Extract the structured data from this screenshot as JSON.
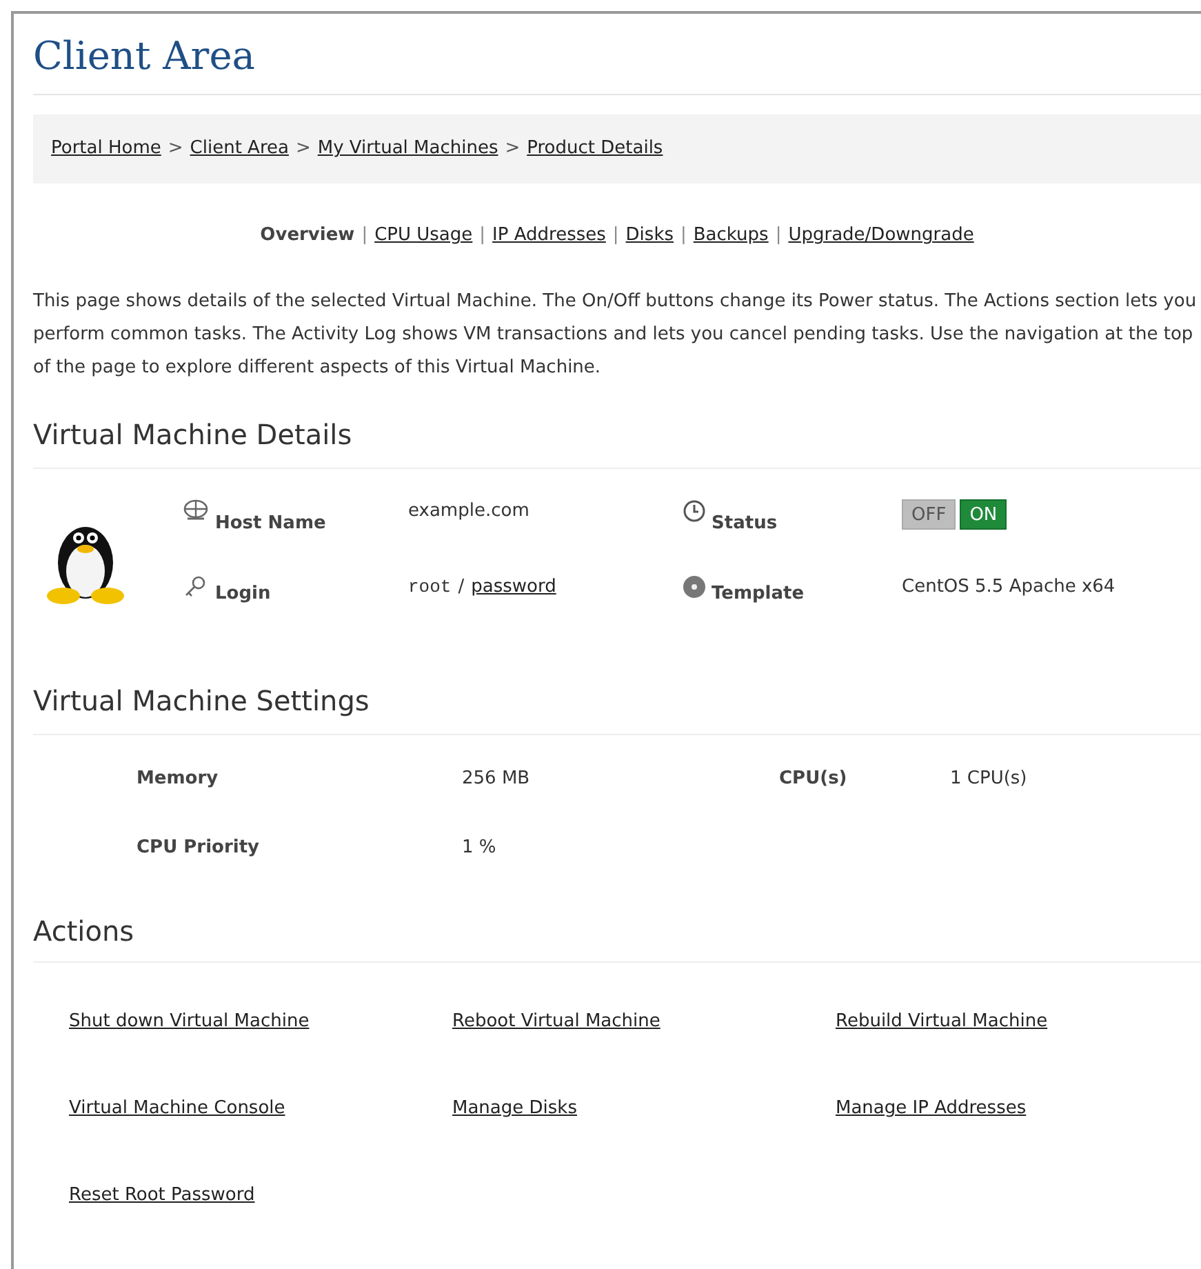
{
  "title": "Client Area",
  "breadcrumb": [
    "Portal Home",
    "Client Area",
    "My Virtual Machines",
    "Product Details"
  ],
  "breadcrumb_separator": ">",
  "nav": [
    {
      "label": "Overview",
      "selected": true
    },
    {
      "label": "CPU Usage",
      "selected": false
    },
    {
      "label": "IP Addresses",
      "selected": false
    },
    {
      "label": "Disks",
      "selected": false
    },
    {
      "label": "Backups",
      "selected": false
    },
    {
      "label": "Upgrade/Downgrade",
      "selected": false
    }
  ],
  "nav_separator": "|",
  "intro": "This page shows details of the selected Virtual Machine. The On/Off buttons change its Power status. The Actions section lets you perform common tasks. The Activity Log shows VM transactions and lets you cancel pending tasks. Use the navigation at the top of the page to explore different aspects of this Virtual Machine.",
  "details": {
    "heading": "Virtual Machine Details",
    "host_name": {
      "label": "Host Name",
      "value": "example.com"
    },
    "login": {
      "label": "Login",
      "user": "root",
      "separator": "/",
      "password_link": "password"
    },
    "status": {
      "label": "Status",
      "off_label": "OFF",
      "on_label": "ON",
      "on": true
    },
    "template": {
      "label": "Template",
      "value": "CentOS 5.5 Apache x64"
    }
  },
  "settings": {
    "heading": "Virtual Machine Settings",
    "items": [
      {
        "label": "Memory",
        "value": "256 MB"
      },
      {
        "label": "CPU(s)",
        "value": "1 CPU(s)"
      },
      {
        "label": "CPU Priority",
        "value": "1 %"
      }
    ]
  },
  "actions": {
    "heading": "Actions",
    "links": [
      "Shut down Virtual Machine",
      "Reboot Virtual Machine",
      "Rebuild Virtual Machine",
      "Virtual Machine Console",
      "Manage Disks",
      "Manage IP Addresses",
      "Reset Root Password"
    ]
  }
}
